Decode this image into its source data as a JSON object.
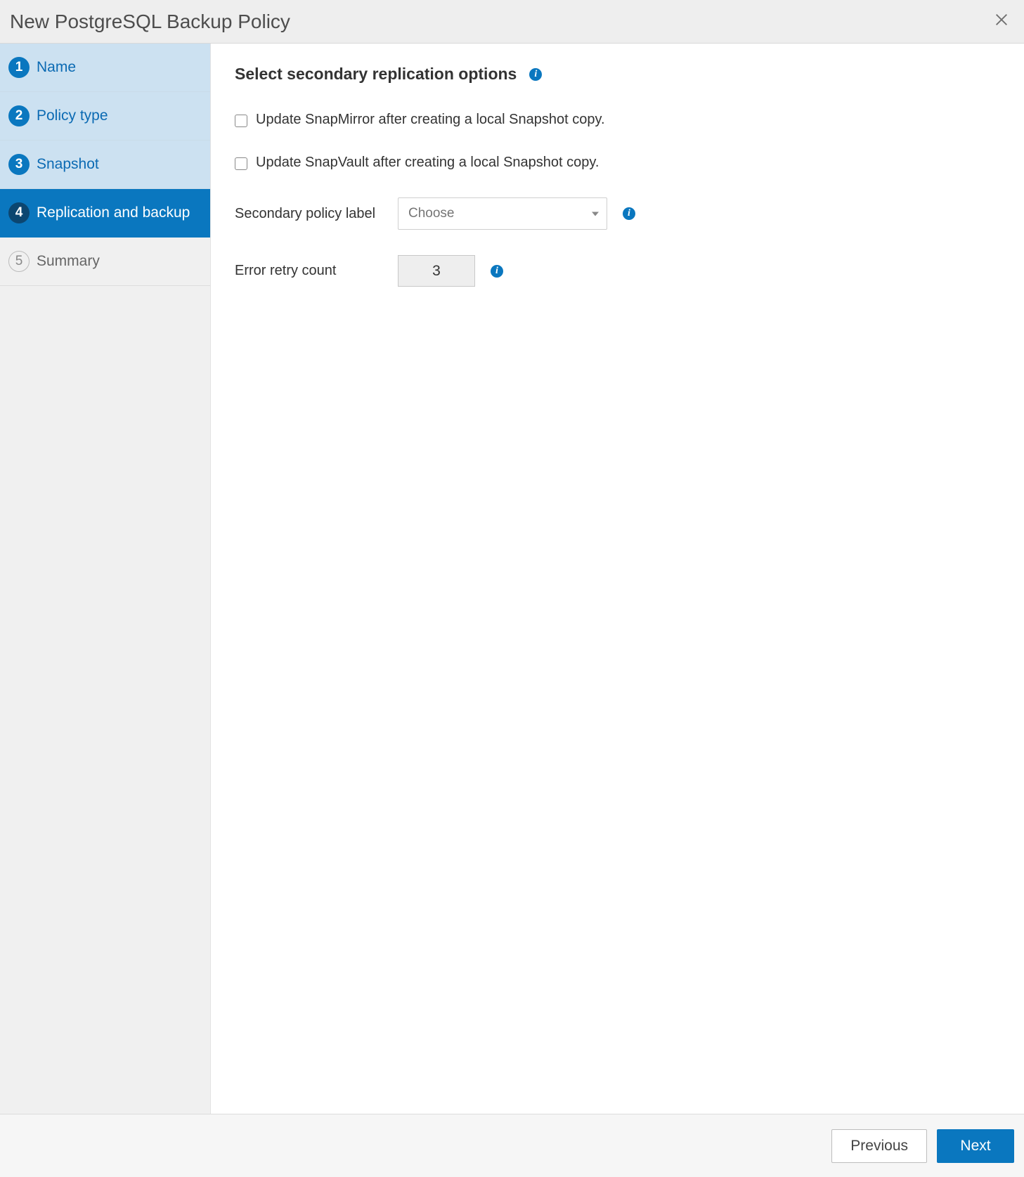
{
  "header": {
    "title": "New PostgreSQL Backup Policy"
  },
  "sidebar": {
    "steps": [
      {
        "num": "1",
        "label": "Name",
        "state": "completed"
      },
      {
        "num": "2",
        "label": "Policy type",
        "state": "completed"
      },
      {
        "num": "3",
        "label": "Snapshot",
        "state": "completed"
      },
      {
        "num": "4",
        "label": "Replication and backup",
        "state": "active"
      },
      {
        "num": "5",
        "label": "Summary",
        "state": "pending"
      }
    ]
  },
  "main": {
    "section_title": "Select secondary replication options",
    "snapmirror_label": "Update SnapMirror after creating a local Snapshot copy.",
    "snapvault_label": "Update SnapVault after creating a local Snapshot copy.",
    "policy_label_text": "Secondary policy label",
    "policy_select_placeholder": "Choose",
    "retry_label": "Error retry count",
    "retry_value": "3"
  },
  "footer": {
    "previous": "Previous",
    "next": "Next"
  }
}
